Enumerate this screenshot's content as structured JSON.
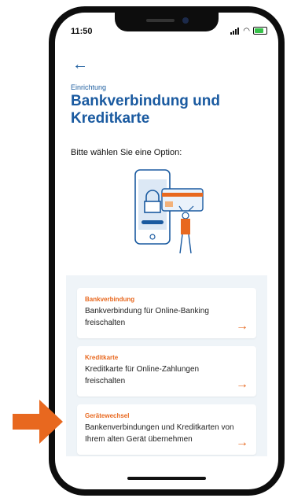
{
  "status_bar": {
    "time": "11:50"
  },
  "nav": {
    "back_icon": "arrow-left-icon"
  },
  "header": {
    "eyebrow": "Einrichtung",
    "title": "Bankverbindung und Kreditkarte"
  },
  "subtitle": "Bitte wählen Sie eine Option:",
  "options": [
    {
      "label": "Bankverbindung",
      "description": "Bankverbindung für Online-Banking freischalten"
    },
    {
      "label": "Kreditkarte",
      "description": "Kreditkarte für Online-Zahlungen freischalten"
    },
    {
      "label": "Gerätewechsel",
      "description": "Bankenverbindungen und Kreditkarten von Ihrem alten Gerät übernehmen"
    }
  ],
  "colors": {
    "accent": "#e8681f",
    "brand": "#1a5aa0",
    "pointer": "#e8681f"
  }
}
